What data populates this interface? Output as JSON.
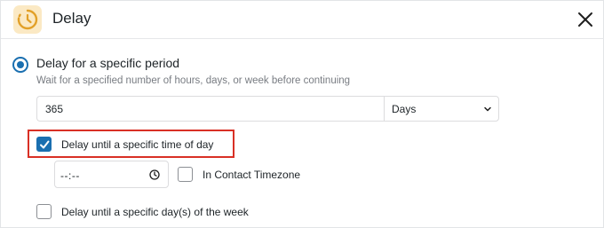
{
  "header": {
    "title": "Delay",
    "icon": "clock-icon",
    "close_icon": "close-icon"
  },
  "delay_period": {
    "radio_label": "Delay for a specific period",
    "description": "Wait for a specified number of hours, days, or week before continuing",
    "amount_value": "365",
    "unit_selected": "Days",
    "selected": true
  },
  "time_of_day": {
    "label": "Delay until a specific time of day",
    "checked": true,
    "time_value": "--:--",
    "timezone_label": "In Contact Timezone",
    "timezone_checked": false
  },
  "day_of_week": {
    "label": "Delay until a specific day(s) of the week",
    "checked": false
  },
  "colors": {
    "accent": "#1a6fb0",
    "highlight_border": "#d93025",
    "icon_bg": "#fbe9c4",
    "icon_fg": "#e2a028"
  }
}
